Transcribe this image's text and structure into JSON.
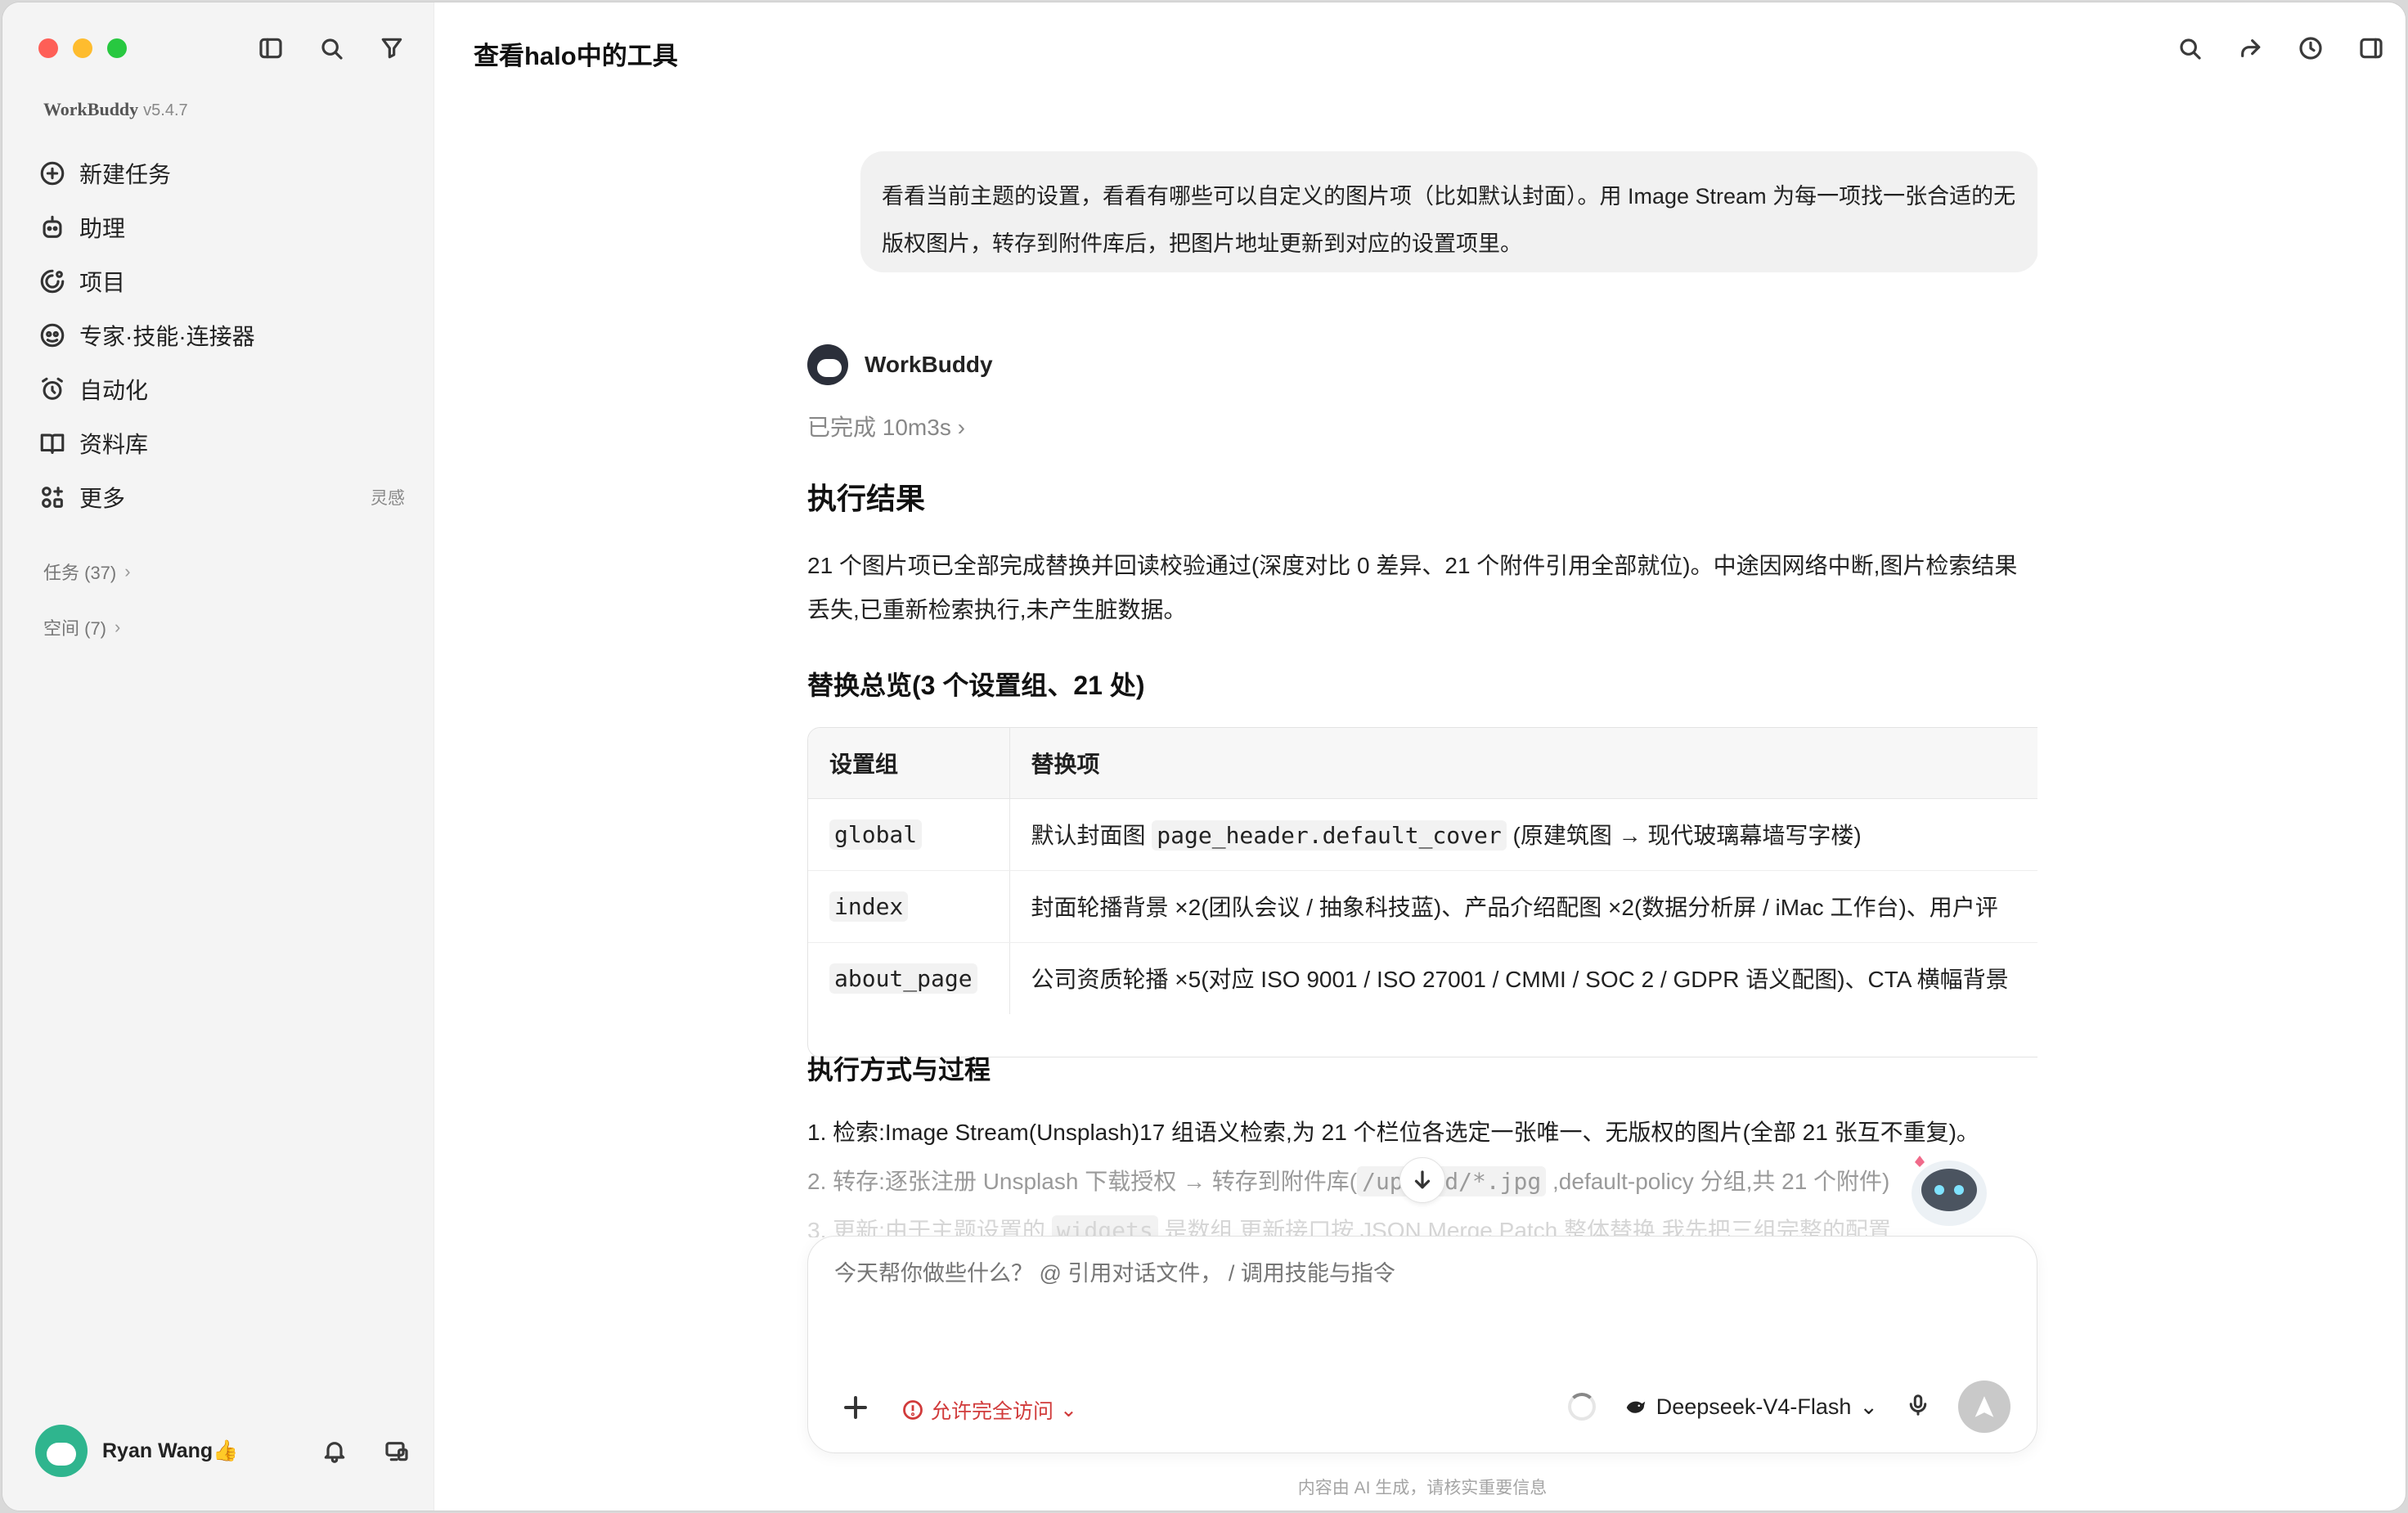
{
  "app": {
    "brand": "WorkBuddy",
    "version": "v5.4.7",
    "conversation_title": "查看halo中的工具"
  },
  "sidebar": {
    "items": [
      {
        "label": "新建任务",
        "icon": "plus-circle-icon"
      },
      {
        "label": "助理",
        "icon": "robot-icon"
      },
      {
        "label": "项目",
        "icon": "project-icon"
      },
      {
        "label": "专家·技能·连接器",
        "icon": "expert-icon"
      },
      {
        "label": "自动化",
        "icon": "alarm-icon"
      },
      {
        "label": "资料库",
        "icon": "book-icon"
      },
      {
        "label": "更多",
        "icon": "grid-icon",
        "tag": "灵感"
      }
    ],
    "sections": [
      {
        "label": "任务 (37)"
      },
      {
        "label": "空间 (7)"
      }
    ],
    "user": {
      "name": "Ryan Wang👍"
    }
  },
  "chat": {
    "user_message": "看看当前主题的设置，看看有哪些可以自定义的图片项（比如默认封面）。用 Image Stream 为每一项找一张合适的无版权图片，转存到附件库后，把图片地址更新到对应的设置项里。",
    "bot_name": "WorkBuddy",
    "status": "已完成 10m3s",
    "result_title": "执行结果",
    "result_text": "21 个图片项已全部完成替换并回读校验通过(深度对比 0 差异、21 个附件引用全部就位)。中途因网络中断,图片检索结果丢失,已重新检索执行,未产生脏数据。",
    "overview_title": "替换总览(3 个设置组、21 处)",
    "table": {
      "headers": [
        "设置组",
        "替换项"
      ],
      "rows": [
        {
          "group": "global",
          "pre": "默认封面图 ",
          "code": "page_header.default_cover",
          "post": " (原建筑图 → 现代玻璃幕墙写字楼)"
        },
        {
          "group": "index",
          "pre": "封面轮播背景 ×2(团队会议 / 抽象科技蓝)、产品介绍配图 ×2(数据分析屏 / iMac 工作台)、用户评",
          "code": "",
          "post": ""
        },
        {
          "group": "about_page",
          "pre": "公司资质轮播 ×5(对应 ISO 9001 / ISO 27001 / CMMI / SOC 2 / GDPR 语义配图)、CTA 横幅背景",
          "code": "",
          "post": ""
        }
      ]
    },
    "process_title": "执行方式与过程",
    "steps": [
      {
        "pre": "1. 检索:Image Stream(Unsplash)17 组语义检索,为 21 个栏位各选定一张唯一、无版权的图片(全部 21 张互不重复)。",
        "code": "",
        "post": ""
      },
      {
        "pre": "2. 转存:逐张注册 Unsplash 下载授权 → 转存到附件库(",
        "code": "/upload/*.jpg",
        "post": " ,default-policy 分组,共 21 个附件)"
      },
      {
        "pre": "3. 更新:由于主题设置的 ",
        "code": "widgets",
        "post": " 是数组,更新接口按 JSON Merge Patch 整体替换,我先把三组完整的配置..."
      }
    ]
  },
  "composer": {
    "placeholder": "今天帮你做些什么？ @ 引用对话文件， / 调用技能与指令",
    "access_label": "允许完全访问",
    "model": "Deepseek-V4-Flash",
    "disclaimer": "内容由 AI 生成，请核实重要信息"
  },
  "colors": {
    "accent_red": "#d13b3b",
    "sidebar_bg": "#f4f4f4",
    "bubble_bg": "#f1f1f1"
  }
}
